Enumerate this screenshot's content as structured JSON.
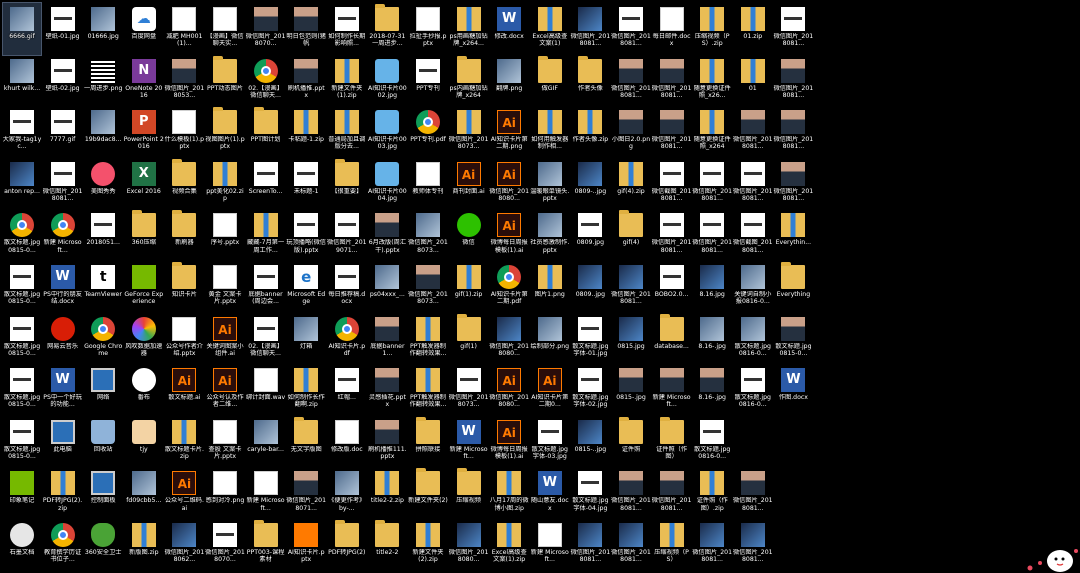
{
  "desktop": {
    "icons": [
      {
        "label": "6666.gif",
        "type": "img",
        "selected": true
      },
      {
        "label": "壁纸-01.jpg",
        "type": "strip"
      },
      {
        "label": "01666.jpg",
        "type": "img"
      },
      {
        "label": "百度网盘",
        "type": "cloud"
      },
      {
        "label": "减肥 MH001(1)...",
        "type": "doc"
      },
      {
        "label": "【漫画】微信聊天实...",
        "type": "doc"
      },
      {
        "label": "微信图片_2018070...",
        "type": "photo"
      },
      {
        "label": "明日包范则(猪帆",
        "type": "photo"
      },
      {
        "label": "如何制作长期影响照...",
        "type": "strip"
      },
      {
        "label": "2018-07-31一周进步...",
        "type": "folder"
      },
      {
        "label": "拉扯手抄报.pptx",
        "type": "doc"
      },
      {
        "label": "ps用画糖加钻牌_x264...",
        "type": "zip"
      },
      {
        "label": "修改.docx",
        "type": "word"
      },
      {
        "label": "Excel高级查文案(1)",
        "type": "zip"
      },
      {
        "label": "微信图片_2018081...",
        "type": "img2"
      },
      {
        "label": "微信图片_2018081...",
        "type": "strip"
      },
      {
        "label": "每日邮件.docx",
        "type": "doc"
      },
      {
        "label": "压缩视频（PS）.zip",
        "type": "zip"
      },
      {
        "label": "01.zip",
        "type": "zip"
      },
      {
        "label": "微信图片_2018081...",
        "type": "strip"
      },
      {
        "label": "khurt wilk...",
        "type": "img"
      },
      {
        "label": "壁纸-02.jpg",
        "type": "strip"
      },
      {
        "label": "一周进步.png",
        "type": "qr"
      },
      {
        "label": "OneNote 2016",
        "type": "onenote"
      },
      {
        "label": "微信图片_2018053...",
        "type": "photo"
      },
      {
        "label": "PPT动态图片",
        "type": "folder"
      },
      {
        "label": "02.【漫画】微信聊天...",
        "type": "chrome"
      },
      {
        "label": "刷机播推.pptx",
        "type": "photo"
      },
      {
        "label": "新建文件夹(1).zip",
        "type": "zip"
      },
      {
        "label": "AI知识卡片0002.jpg",
        "type": "sticky"
      },
      {
        "label": "PPT专刊",
        "type": "strip"
      },
      {
        "label": "ps内画糖加钻牌_x264",
        "type": "folder"
      },
      {
        "label": "翻牌.png",
        "type": "img"
      },
      {
        "label": "做GIF",
        "type": "folder"
      },
      {
        "label": "作者头像",
        "type": "folder"
      },
      {
        "label": "微信图片_2018081...",
        "type": "photo"
      },
      {
        "label": "微信图片_2018081...",
        "type": "photo"
      },
      {
        "label": "随意更换证件照_x26...",
        "type": "zip"
      },
      {
        "label": "01",
        "type": "zip"
      },
      {
        "label": "微信图片_2018081...",
        "type": "photo"
      },
      {
        "label": "大家我-tag1yc...",
        "type": "strip"
      },
      {
        "label": "7777.gif",
        "type": "strip"
      },
      {
        "label": "19b9dac8...",
        "type": "img"
      },
      {
        "label": "PowerPoint 2016",
        "type": "ppt"
      },
      {
        "label": "什么模板(1).pptx",
        "type": "doc"
      },
      {
        "label": "视图图片(1).pptx",
        "type": "folder"
      },
      {
        "label": "PPT图计划",
        "type": "folder"
      },
      {
        "label": "卡粘题-1.zip",
        "type": "zip"
      },
      {
        "label": "普通局加且调版分去...",
        "type": "zip"
      },
      {
        "label": "AI知识卡片0003.jpg",
        "type": "sticky"
      },
      {
        "label": "PPT专刊.pdf",
        "type": "chrome"
      },
      {
        "label": "微信图片_2018073...",
        "type": "zip"
      },
      {
        "label": "AI知识卡片第二期.png",
        "type": "ai"
      },
      {
        "label": "如何用触发器制作相...",
        "type": "zip"
      },
      {
        "label": "作者头像.zip",
        "type": "zip"
      },
      {
        "label": "小图日2.0.png",
        "type": "photo"
      },
      {
        "label": "微信图片_2018081...",
        "type": "photo"
      },
      {
        "label": "随意更换证件照_x264",
        "type": "zip"
      },
      {
        "label": "微信图片_2018081...",
        "type": "photo"
      },
      {
        "label": "微信图片_2018081...",
        "type": "photo"
      },
      {
        "label": "anton rep...",
        "type": "img2"
      },
      {
        "label": "微信图片_2018081...",
        "type": "strip"
      },
      {
        "label": "美图秀秀",
        "type": "meitu"
      },
      {
        "label": "Excel 2016",
        "type": "excel"
      },
      {
        "label": "视频合集",
        "type": "folder"
      },
      {
        "label": "ppt美化02.zip",
        "type": "zip"
      },
      {
        "label": "ScreenTo...",
        "type": "strip"
      },
      {
        "label": "未标题-1",
        "type": "strip"
      },
      {
        "label": "【很重要】",
        "type": "folder"
      },
      {
        "label": "AI知识卡片0004.jpg",
        "type": "sticky"
      },
      {
        "label": "教师体专刊",
        "type": "doc"
      },
      {
        "label": "商刊封面.ai",
        "type": "ai"
      },
      {
        "label": "微信图片_2018080...",
        "type": "ai"
      },
      {
        "label": "温暖眼单镜头.pptx",
        "type": "img"
      },
      {
        "label": "0809-..jpg",
        "type": "img2"
      },
      {
        "label": "gif(4).zip",
        "type": "zip"
      },
      {
        "label": "微信截图_2018081...",
        "type": "strip"
      },
      {
        "label": "微信图片_2018081...",
        "type": "strip"
      },
      {
        "label": "微信图片_2018081...",
        "type": "strip"
      },
      {
        "label": "微信图片_2018081...",
        "type": "photo"
      },
      {
        "label": "散文标题.jpg0815-0...",
        "type": "chrome"
      },
      {
        "label": "新建 Microsoft...",
        "type": "chrome"
      },
      {
        "label": "2018051...",
        "type": "strip"
      },
      {
        "label": "360压缩",
        "type": "folder"
      },
      {
        "label": "新刷器",
        "type": "folder"
      },
      {
        "label": "序号.pptx",
        "type": "doc"
      },
      {
        "label": "藏藏-7月第一周工作...",
        "type": "zip"
      },
      {
        "label": "玩顶播略(微信版).pptx",
        "type": "strip"
      },
      {
        "label": "微信图片_2019071...",
        "type": "strip"
      },
      {
        "label": "6月改版(周汇干).pptx",
        "type": "photo"
      },
      {
        "label": "微信图片_2018073...",
        "type": "img"
      },
      {
        "label": "微信",
        "type": "wechat"
      },
      {
        "label": "微博每日周报模板(1).ai",
        "type": "ai"
      },
      {
        "label": "社员感激制作.pptx",
        "type": "img"
      },
      {
        "label": "0809.jpg",
        "type": "strip"
      },
      {
        "label": "gif(4)",
        "type": "folder"
      },
      {
        "label": "微信图片_2018081...",
        "type": "strip"
      },
      {
        "label": "微信图片_2018081...",
        "type": "strip"
      },
      {
        "label": "微信截图_2018081...",
        "type": "strip"
      },
      {
        "label": "Everythin...",
        "type": "zip"
      },
      {
        "label": "散文标题.jpg0815-0...",
        "type": "strip"
      },
      {
        "label": "PS中行的朋友结.docx",
        "type": "word"
      },
      {
        "label": "TeamViewer",
        "type": "teamviewer"
      },
      {
        "label": "GeForce Experience",
        "type": "geforce"
      },
      {
        "label": "知识卡片",
        "type": "folder"
      },
      {
        "label": "黄金 文案卡片.pptx",
        "type": "doc"
      },
      {
        "label": "底据banner(周边会...",
        "type": "strip"
      },
      {
        "label": "Microsoft Edge",
        "type": "edge"
      },
      {
        "label": "每日推荐稿.docx",
        "type": "strip"
      },
      {
        "label": "ps04xxx_...",
        "type": "img"
      },
      {
        "label": "微信图片_2018073...",
        "type": "photo"
      },
      {
        "label": "gif(1).zip",
        "type": "zip"
      },
      {
        "label": "AI知识卡片第二期.pdf",
        "type": "chrome"
      },
      {
        "label": "图片1.png",
        "type": "zip"
      },
      {
        "label": "0809..jpg",
        "type": "img2"
      },
      {
        "label": "微信图片_2018081...",
        "type": "img2"
      },
      {
        "label": "BOBO2.0...",
        "type": "strip"
      },
      {
        "label": "8.16.jpg",
        "type": "img2"
      },
      {
        "label": "关键词自制小报0816-0...",
        "type": "img"
      },
      {
        "label": "Everything",
        "type": "folder"
      },
      {
        "label": "散文标题.jpg0815-0...",
        "type": "strip"
      },
      {
        "label": "网易云音乐",
        "type": "netease"
      },
      {
        "label": "Google Chrome",
        "type": "chrome"
      },
      {
        "label": "风吹数据加速器",
        "type": "pinwheel"
      },
      {
        "label": "公众号作者介绍.pptx",
        "type": "doc"
      },
      {
        "label": "关键词图案小组件.ai",
        "type": "ai"
      },
      {
        "label": "02.【漫画】微信聊天...",
        "type": "strip"
      },
      {
        "label": "灯箱",
        "type": "img"
      },
      {
        "label": "AI知识卡片.pdf",
        "type": "chrome"
      },
      {
        "label": "底据banner1...",
        "type": "photo"
      },
      {
        "label": "PPT触发器制作翻转效果...",
        "type": "zip"
      },
      {
        "label": "gif(1)",
        "type": "folder"
      },
      {
        "label": "微信图片_2018080...",
        "type": "img2"
      },
      {
        "label": "绘制部分.png",
        "type": "img"
      },
      {
        "label": "散文标题.jpg字体-01.jpg",
        "type": "strip"
      },
      {
        "label": "0815.jpg",
        "type": "img2"
      },
      {
        "label": "database...",
        "type": "folder"
      },
      {
        "label": "8.16-.jpg",
        "type": "img"
      },
      {
        "label": "散文标题.jpg0816-0...",
        "type": "img"
      },
      {
        "label": "散文标题.jpg0815-0...",
        "type": "photo"
      },
      {
        "label": "散文标题.jpg0815-0...",
        "type": "strip"
      },
      {
        "label": "PS中一个好玩的功能...",
        "type": "word"
      },
      {
        "label": "网络",
        "type": "monitor"
      },
      {
        "label": "番布",
        "type": "film"
      },
      {
        "label": "散文标题.ai",
        "type": "ai"
      },
      {
        "label": "公众号认及作者二维...",
        "type": "ai"
      },
      {
        "label": "绑计封面.wav",
        "type": "doc"
      },
      {
        "label": "如何制作长作翻啊.zip",
        "type": "zip"
      },
      {
        "label": "红帽...",
        "type": "strip"
      },
      {
        "label": "灵感插花.pptx",
        "type": "photo"
      },
      {
        "label": "PPT触发器制作翻转效果...",
        "type": "zip"
      },
      {
        "label": "微信图片_2018073...",
        "type": "strip"
      },
      {
        "label": "微信图片_2018080...",
        "type": "ai"
      },
      {
        "label": "AI知识卡片第二期0...",
        "type": "ai"
      },
      {
        "label": "散文标题.jpg字体-02.jpg",
        "type": "strip"
      },
      {
        "label": "0815-.jpg",
        "type": "photo"
      },
      {
        "label": "新建 Microsoft...",
        "type": "photo"
      },
      {
        "label": "8.16-.jpg",
        "type": "photo"
      },
      {
        "label": "散文标题.jpg0816-0...",
        "type": "strip"
      },
      {
        "label": "作图.docx",
        "type": "word"
      },
      {
        "label": "散文标题.jpg0815-0...",
        "type": "strip"
      },
      {
        "label": "此电脑",
        "type": "monitor"
      },
      {
        "label": "回收站",
        "type": "recycle"
      },
      {
        "label": "tjy",
        "type": "tea"
      },
      {
        "label": "散文标题卡片.zip",
        "type": "zip"
      },
      {
        "label": "查股 文案卡片.pptx",
        "type": "doc"
      },
      {
        "label": "caryle-bar...",
        "type": "img"
      },
      {
        "label": "无文字版图",
        "type": "folder"
      },
      {
        "label": "修改版.doc",
        "type": "doc"
      },
      {
        "label": "刷机播推111.pptx",
        "type": "photo"
      },
      {
        "label": "拼照联接",
        "type": "folder"
      },
      {
        "label": "新建 Microsoft...",
        "type": "word"
      },
      {
        "label": "微博每日周报模板(1).ai",
        "type": "ai"
      },
      {
        "label": "散文标题.jpg字体-03.jpg",
        "type": "strip"
      },
      {
        "label": "0815-..jpg",
        "type": "img2"
      },
      {
        "label": "证件照",
        "type": "folder"
      },
      {
        "label": "证件照（作图）",
        "type": "folder"
      },
      {
        "label": "散文标题.jpg0816-0...",
        "type": "strip"
      },
      {
        "label": "",
        "type": "none"
      },
      {
        "label": "",
        "type": "none"
      },
      {
        "label": "印象笔记",
        "type": "geforce"
      },
      {
        "label": "PDF转JPG(2).zip",
        "type": "zip"
      },
      {
        "label": "控制面板",
        "type": "monitor"
      },
      {
        "label": "fd09cbb5...",
        "type": "img"
      },
      {
        "label": "公众号二维码.ai",
        "type": "ai"
      },
      {
        "label": "感到对冷.png",
        "type": "doc"
      },
      {
        "label": "新建 Microsoft...",
        "type": "doc"
      },
      {
        "label": "微信图片_2018071...",
        "type": "photo"
      },
      {
        "label": "《便更作考》by-...",
        "type": "img"
      },
      {
        "label": "title2-2.zip",
        "type": "zip"
      },
      {
        "label": "新建文件夹(2)",
        "type": "folder"
      },
      {
        "label": "压缩视频",
        "type": "folder"
      },
      {
        "label": "八月17周的微博小图.zip",
        "type": "zip"
      },
      {
        "label": "随山意友.docx",
        "type": "word"
      },
      {
        "label": "散文标题.jpg字体-04.jpg",
        "type": "strip"
      },
      {
        "label": "微信图片_2018081...",
        "type": "photo"
      },
      {
        "label": "微信图片_2018081...",
        "type": "photo"
      },
      {
        "label": "证件照（作图）.zip",
        "type": "zip"
      },
      {
        "label": "微信图片_2018081...",
        "type": "photo"
      },
      {
        "label": "",
        "type": "none"
      },
      {
        "label": "石墨文档",
        "type": "ecircle"
      },
      {
        "label": "教育撰学历证书位子...",
        "type": "chrome"
      },
      {
        "label": "360安全卫士",
        "type": "shield"
      },
      {
        "label": "新版图.zip",
        "type": "zip"
      },
      {
        "label": "微信图片_2018062...",
        "type": "img2"
      },
      {
        "label": "微信图片_2018070...",
        "type": "strip"
      },
      {
        "label": "PPT003-课程素材",
        "type": "folder"
      },
      {
        "label": "AI知识卡片.pptx",
        "type": "pdf-ai"
      },
      {
        "label": "PDF转JPG(2)",
        "type": "folder"
      },
      {
        "label": "title2-2",
        "type": "folder"
      },
      {
        "label": "新建文件夹(2).zip",
        "type": "zip"
      },
      {
        "label": "微信图片_2018080...",
        "type": "img2"
      },
      {
        "label": "Excel高级查文案(1).zip",
        "type": "zip"
      },
      {
        "label": "新建 Microsoft...",
        "type": "doc"
      },
      {
        "label": "微信图片_2018081...",
        "type": "img2"
      },
      {
        "label": "微信图片_2018081...",
        "type": "img2"
      },
      {
        "label": "压缩视频（PS）",
        "type": "zip"
      },
      {
        "label": "微信图片_2018081...",
        "type": "img2"
      },
      {
        "label": "微信图片_2018081...",
        "type": "img2"
      },
      {
        "label": "",
        "type": "none"
      }
    ]
  }
}
